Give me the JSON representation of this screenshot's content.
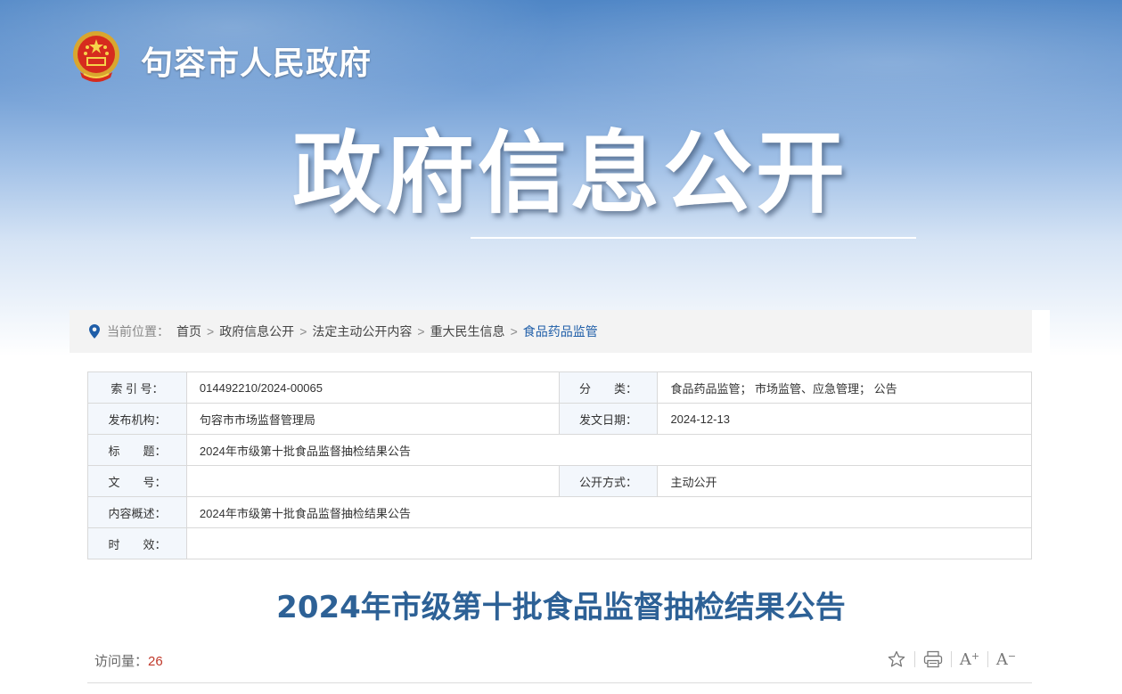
{
  "header": {
    "site_name": "句容市人民政府",
    "banner_title": "政府信息公开"
  },
  "breadcrumb": {
    "prefix": "当前位置：",
    "items": [
      "首页",
      "政府信息公开",
      "法定主动公开内容",
      "重大民生信息",
      "食品药品监管"
    ],
    "separator": ">"
  },
  "meta_table": {
    "index_label": "索 引 号：",
    "index_value": "014492210/2024-00065",
    "category_label": "分　　类：",
    "category_value": "食品药品监管； 市场监管、应急管理； 公告",
    "publisher_label": "发布机构：",
    "publisher_value": "句容市市场监督管理局",
    "date_label": "发文日期：",
    "date_value": "2024-12-13",
    "title_label": "标　　题：",
    "title_value": "2024年市级第十批食品监督抽检结果公告",
    "docno_label": "文　　号：",
    "docno_value": "",
    "openmode_label": "公开方式：",
    "openmode_value": "主动公开",
    "summary_label": "内容概述：",
    "summary_value": "2024年市级第十批食品监督抽检结果公告",
    "validity_label": "时　　效：",
    "validity_value": ""
  },
  "article": {
    "title": "2024年市级第十批食品监督抽检结果公告",
    "visits_label": "访问量：",
    "visits_count": "26"
  },
  "tools": {
    "favorite_icon": "star-icon",
    "print_icon": "printer-icon",
    "font_larger": "A",
    "font_smaller": "A",
    "plus_mark": "+",
    "minus_mark": "−"
  },
  "colors": {
    "brand_blue": "#2d6196",
    "link_blue": "#1f5ea8",
    "count_red": "#c0392b"
  }
}
